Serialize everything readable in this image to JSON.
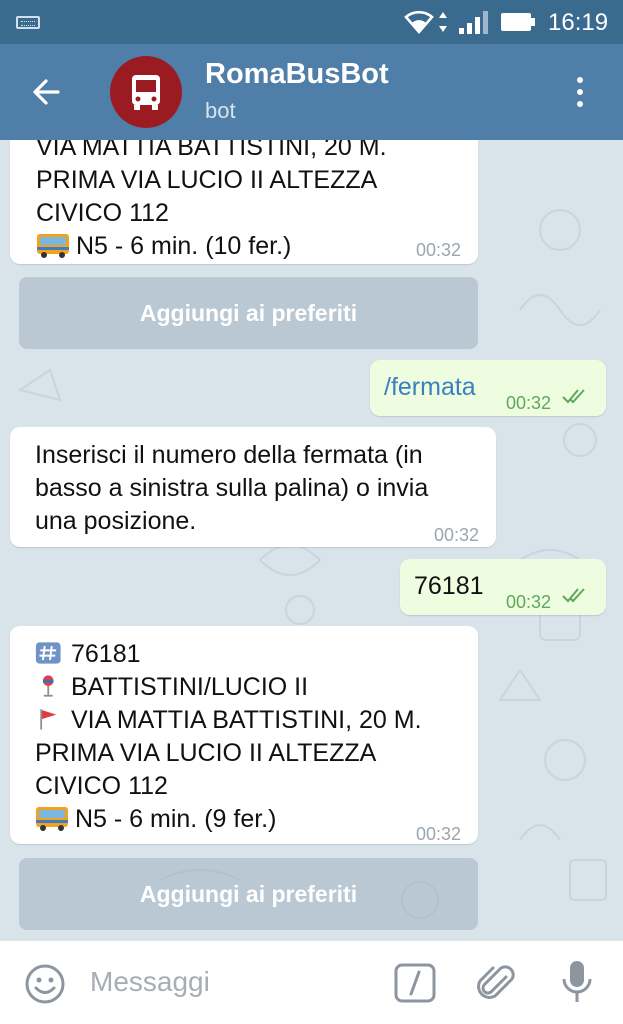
{
  "status_bar": {
    "time": "16:19"
  },
  "header": {
    "title": "RomaBusBot",
    "subtitle": "bot"
  },
  "messages": {
    "m1": {
      "lines": [
        "VIA MATTIA BATTISTINI, 20 M.",
        "PRIMA VIA LUCIO II ALTEZZA",
        "CIVICO 112"
      ],
      "bus_line": "N5  - 6 min. (10 fer.)",
      "time": "00:32"
    },
    "m2": {
      "text": "/fermata",
      "time": "00:32"
    },
    "m3": {
      "lines": [
        "Inserisci il numero della fermata (in",
        "basso a sinistra sulla palina) o invia",
        "una posizione."
      ],
      "time": "00:32"
    },
    "m4": {
      "text": "76181",
      "time": "00:32"
    },
    "m5": {
      "stop_number": "76181",
      "stop_name": "BATTISTINI/LUCIO II",
      "address_first": "VIA MATTIA BATTISTINI, 20 M.",
      "address_rest": [
        "PRIMA VIA LUCIO II ALTEZZA",
        "CIVICO 112"
      ],
      "bus_line": "N5  - 6 min. (9 fer.)",
      "time": "00:32"
    }
  },
  "buttons": {
    "add_favorites_1": "Aggiungi ai preferiti",
    "add_favorites_2": "Aggiungi ai preferiti"
  },
  "composer": {
    "placeholder": "Messaggi"
  },
  "icons": {
    "back": "arrow-left-icon",
    "avatar": "bus-icon",
    "menu": "more-vert-icon",
    "emoji": "smile-icon",
    "commands": "slash-command-icon",
    "attach": "paperclip-icon",
    "voice": "microphone-icon",
    "stop_number": "keycap-hash-icon",
    "stop_name": "bus-stop-icon",
    "address": "red-flag-icon",
    "bus": "bus-front-icon"
  },
  "colors": {
    "status_bar": "#3b6a8f",
    "header": "#4f7ea8",
    "avatar": "#9b1b22",
    "chat_bg": "#d8e3ea",
    "outgoing_bubble": "#eefcdf",
    "incoming_bubble": "#ffffff",
    "read_check": "#5fa85a"
  }
}
